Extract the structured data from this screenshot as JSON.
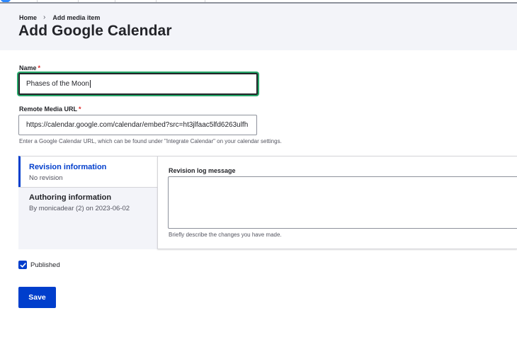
{
  "breadcrumb": {
    "home": "Home",
    "separator": "›",
    "current": "Add media item"
  },
  "page": {
    "title": "Add Google Calendar"
  },
  "form": {
    "name": {
      "label": "Name",
      "required_mark": "*",
      "value": "Phases of the Moon"
    },
    "remote_url": {
      "label": "Remote Media URL",
      "required_mark": "*",
      "value": "https://calendar.google.com/calendar/embed?src=ht3jlfaac5lfd6263ulfh",
      "help": "Enter a Google Calendar URL, which can be found under \"Integrate Calendar\" on your calendar settings."
    },
    "vertical_tabs": [
      {
        "title": "Revision information",
        "summary": "No revision",
        "active": true
      },
      {
        "title": "Authoring information",
        "summary": "By monicadear (2) on 2023-06-02",
        "active": false
      }
    ],
    "revision": {
      "label": "Revision log message",
      "value": "",
      "help": "Briefly describe the changes you have made."
    },
    "published": {
      "label": "Published",
      "checked": true
    },
    "save_label": "Save"
  },
  "colors": {
    "primary": "#003ecc",
    "focus_ring": "#26a769",
    "required": "#dc2323",
    "header_bg": "#f3f4f9"
  },
  "icons": {
    "checkbox": "checkmark-icon",
    "breadcrumb_separator": "chevron-right-icon"
  }
}
